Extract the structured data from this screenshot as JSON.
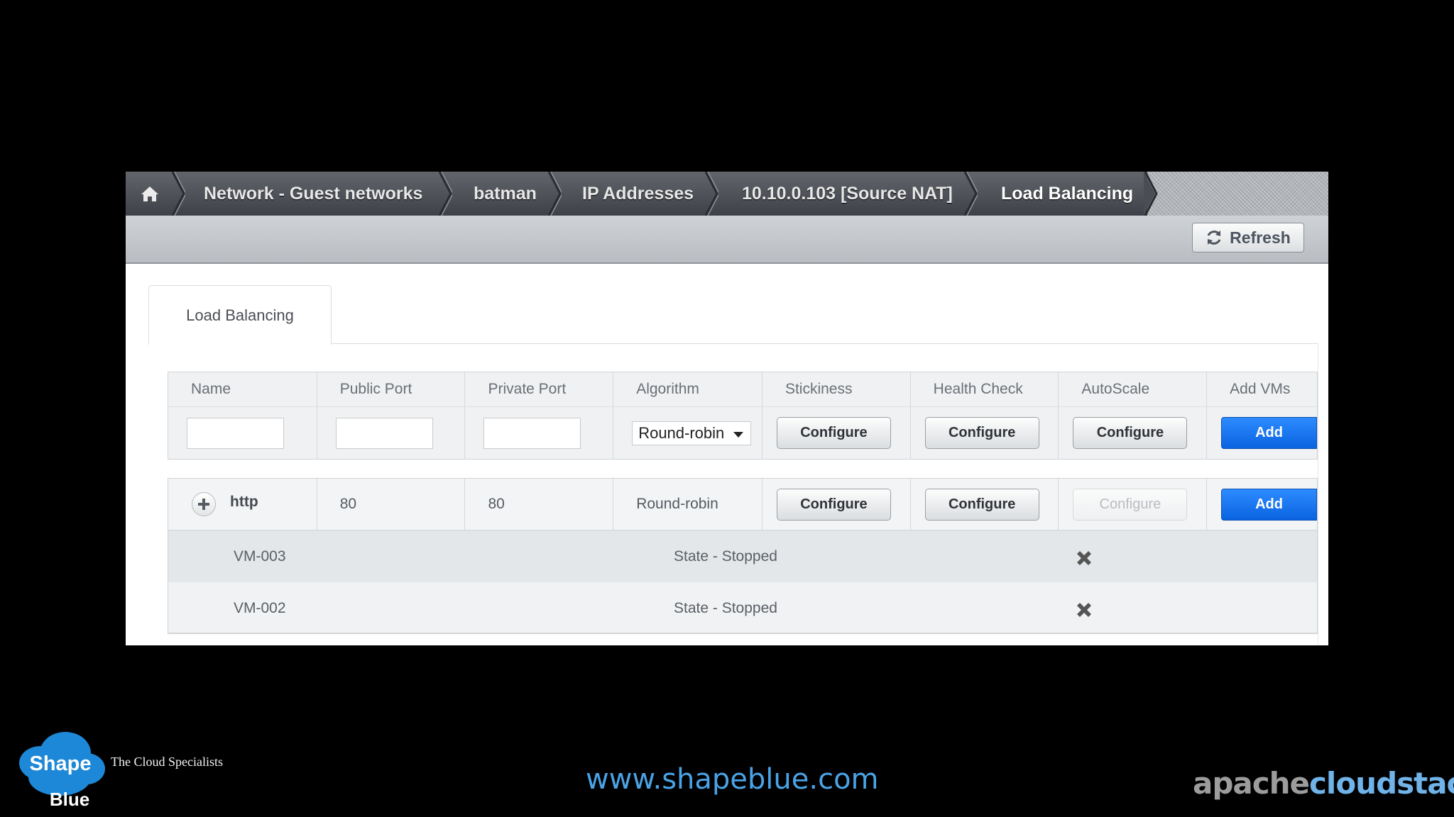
{
  "breadcrumb": {
    "items": [
      "Network - Guest networks",
      "batman",
      "IP Addresses",
      "10.10.0.103 [Source NAT]",
      "Load Balancing"
    ]
  },
  "toolbar": {
    "refresh_label": "Refresh"
  },
  "tabs": [
    {
      "label": "Load Balancing"
    }
  ],
  "table": {
    "columns": [
      "Name",
      "Public Port",
      "Private Port",
      "Algorithm",
      "Stickiness",
      "Health Check",
      "AutoScale",
      "Add VMs"
    ],
    "new_rule": {
      "name": "",
      "public_port": "",
      "private_port": "",
      "algorithm": "Round-robin",
      "stickiness_label": "Configure",
      "health_check_label": "Configure",
      "autoscale_label": "Configure",
      "add_label": "Add"
    },
    "rules": [
      {
        "name": "http",
        "public_port": "80",
        "private_port": "80",
        "algorithm": "Round-robin",
        "stickiness_label": "Configure",
        "health_check_label": "Configure",
        "autoscale_label": "Configure",
        "add_label": "Add",
        "vms": [
          {
            "name": "VM-003",
            "state": "State - Stopped"
          },
          {
            "name": "VM-002",
            "state": "State - Stopped"
          }
        ]
      }
    ]
  },
  "footer": {
    "logo_top": "Shape",
    "logo_bottom": "Blue",
    "tagline": "The Cloud Specialists",
    "website": "www.shapeblue.com",
    "brand_a": "apache",
    "brand_b": "cloudstack",
    "brand_tm": "™"
  },
  "colors": {
    "accent_blue": "#0a63e0",
    "breadcrumb_bg": "#4a4d53",
    "toolbar_bg": "#c4c8cc",
    "website": "#4aa3e6"
  },
  "icons": [
    "home-icon",
    "refresh-icon",
    "chevron-down-icon",
    "plus-icon",
    "remove-icon"
  ]
}
